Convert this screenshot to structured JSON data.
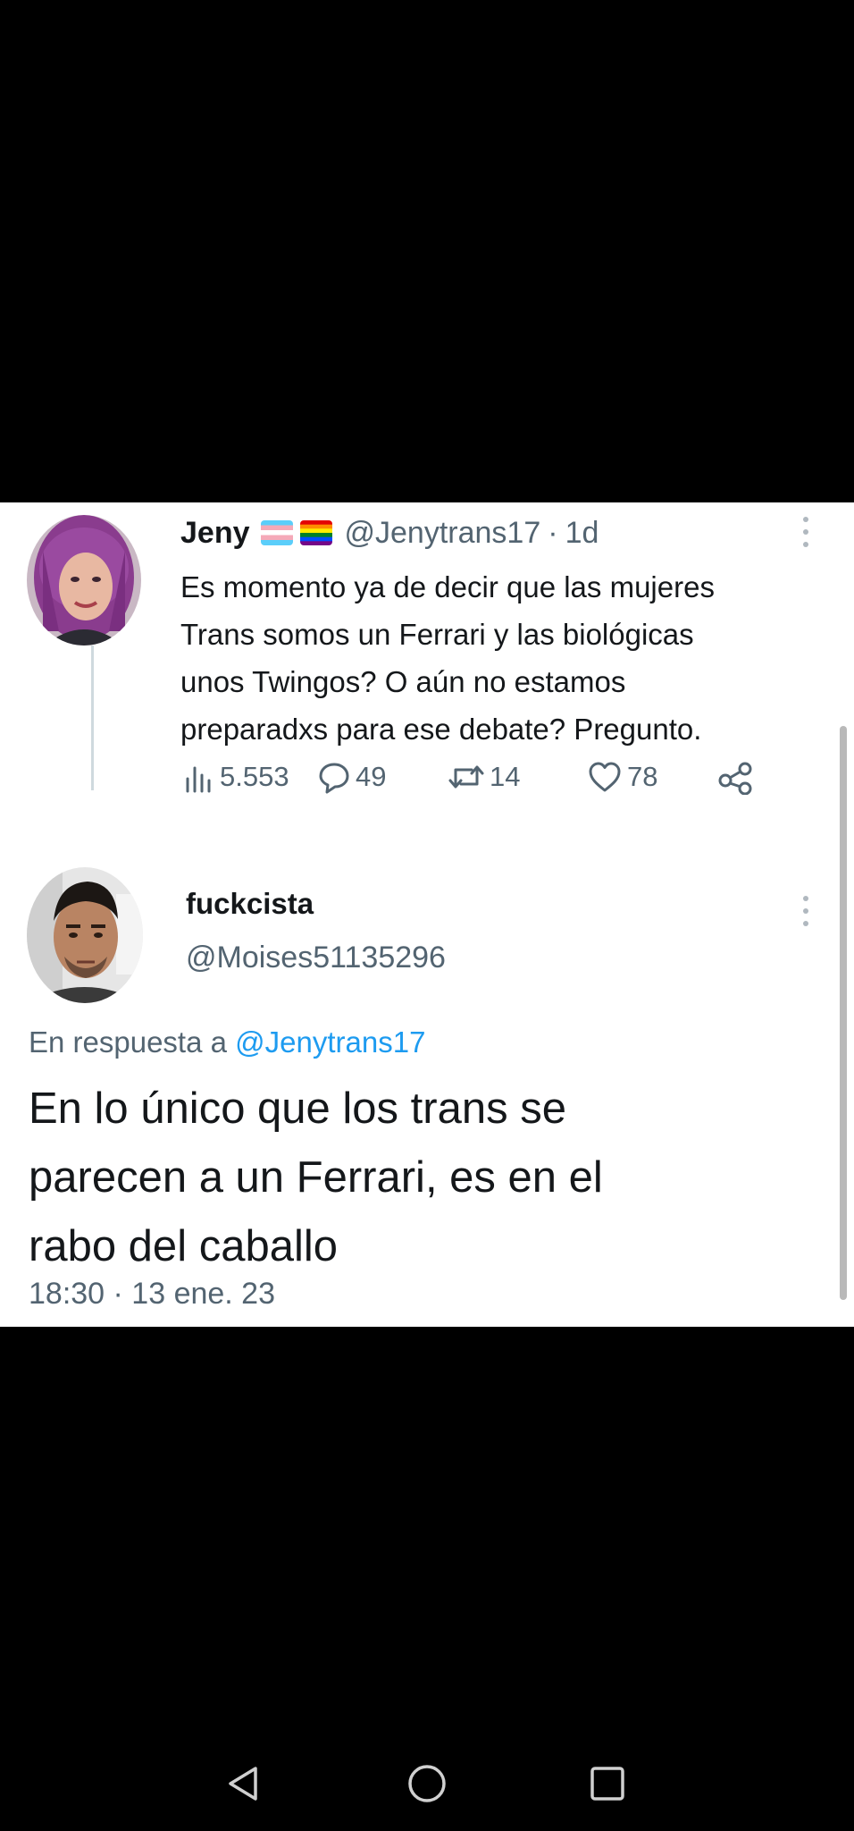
{
  "tweet": {
    "display_name": "Jeny",
    "flags": [
      "transgender-flag-icon",
      "rainbow-flag-icon"
    ],
    "handle": "@Jenytrans17",
    "separator": "·",
    "time": "1d",
    "text": "Es momento ya de decir que las mujeres\nTrans somos un Ferrari y las biológicas\nunos Twingos? O aún no estamos\npreparadxs para ese debate? Pregunto.",
    "metrics": {
      "views": "5.553",
      "replies": "49",
      "retweets": "14",
      "likes": "78"
    }
  },
  "reply": {
    "display_name": "fuckcista",
    "handle": "@Moises51135296",
    "reply_to_prefix": "En respuesta a",
    "reply_to_handle": "@Jenytrans17",
    "text": "En lo único que los trans se\nparecen a un Ferrari, es en el\nrabo del caballo",
    "timestamp": "18:30 · 13 ene. 23"
  },
  "icons": {
    "views": "views-bar-chart-icon",
    "replies": "reply-bubble-icon",
    "retweets": "retweet-icon",
    "likes": "heart-icon",
    "share": "share-icon",
    "more": "more-vertical-icon"
  },
  "navigation": [
    "back-icon",
    "home-icon",
    "recent-apps-icon"
  ],
  "colors": {
    "background": "#000000",
    "card": "#ffffff",
    "text": "#14171a",
    "secondary_text": "#536471",
    "link": "#1d9bf0",
    "thread_line": "#cfd9de"
  }
}
